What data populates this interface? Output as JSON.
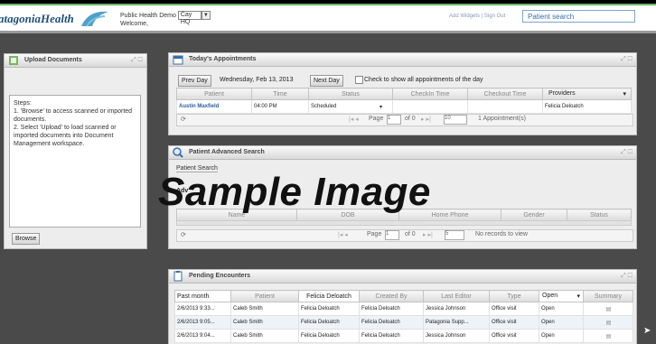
{
  "header": {
    "logo_text": "atagoniaHealth",
    "practice_line1": "Public Health Demo",
    "practice_select": "Cay HQ",
    "practice_line2": "Welcome,",
    "links": "Add Widgets | Sign Out",
    "search_placeholder": "Patient search"
  },
  "upload": {
    "title": "Upload Documents",
    "steps_heading": "Steps:",
    "step1": "1. 'Browse' to access scanned or imported documents.",
    "step2": "2. Select 'Upload' to load scanned or imported documents into Document Management workspace.",
    "browse_label": "Browse"
  },
  "appointments": {
    "title": "Today's Appointments",
    "prev_day": "Prev Day",
    "date": "Wednesday, Feb 13, 2013",
    "next_day": "Next Day",
    "check_all_label": "Check to show all appointments of the day",
    "columns": [
      "Patient",
      "Time",
      "Status",
      "CheckIn Time",
      "Checkout Time",
      "Providers"
    ],
    "row": {
      "patient": "Austin Maxfield",
      "time": "04:00 PM",
      "status": "Scheduled",
      "checkin": "",
      "checkout": "",
      "provider": "Felicia Deloatch"
    },
    "pager_page": "Page",
    "pager_page_value": "1",
    "pager_of": "of 0",
    "pager_size": "10",
    "pager_count": "1 Appointment(s)"
  },
  "advanced_search": {
    "title": "Patient Advanced Search",
    "tab_label": "Patient Search",
    "adv_label": "Adv",
    "columns": [
      "Name",
      "DOB",
      "Home Phone",
      "Gender",
      "Status"
    ],
    "pager_page": "Page",
    "pager_page_value": "1",
    "pager_of": "of 0",
    "pager_size": "5",
    "no_records": "No records to view"
  },
  "encounters": {
    "title": "Pending Encounters",
    "filter_period": "Past month",
    "filter_provider": "Felicia Deloatch",
    "filter_status": "Open",
    "columns": [
      "Patient",
      "Created By",
      "Last Editor",
      "Type",
      "Summary"
    ],
    "rows": [
      {
        "date": "2/6/2013 9:33...",
        "patient": "Caleb Smith",
        "provider": "Felicia Deloatch",
        "created_by": "Felicia Deloatch",
        "editor": "Jessica Johnson",
        "type": "Office visit",
        "status": "Open"
      },
      {
        "date": "2/6/2013 9:05...",
        "patient": "Caleb Smith",
        "provider": "Felicia Deloatch",
        "created_by": "Felicia Deloatch",
        "editor": "Patagonia Supp...",
        "type": "Office visit",
        "status": "Open"
      },
      {
        "date": "2/6/2013 9:04...",
        "patient": "Caleb Smith",
        "provider": "Felicia Deloatch",
        "created_by": "Felicia Deloatch",
        "editor": "Jessica Johnson",
        "type": "Office visit",
        "status": "Open"
      }
    ]
  },
  "watermark": "Sample Image"
}
